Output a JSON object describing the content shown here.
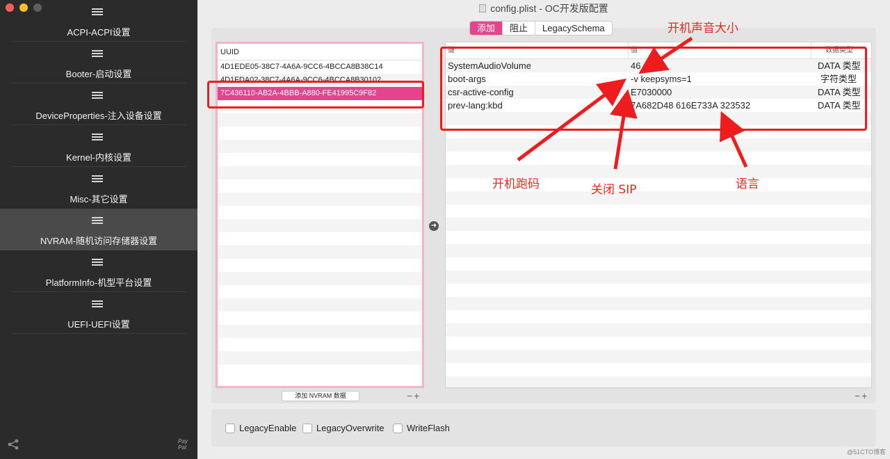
{
  "window": {
    "title": "config.plist - OC开发版配置"
  },
  "sidebar": {
    "items": [
      {
        "label": "ACPI-ACPI设置"
      },
      {
        "label": "Booter-启动设置"
      },
      {
        "label": "DeviceProperties-注入设备设置"
      },
      {
        "label": "Kernel-内核设置"
      },
      {
        "label": "Misc-其它设置"
      },
      {
        "label": "NVRAM-随机访问存储器设置",
        "active": true
      },
      {
        "label": "PlatformInfo-机型平台设置"
      },
      {
        "label": "UEFI-UEFI设置"
      }
    ],
    "paypal_line1": "Pay",
    "paypal_line2": "Pal"
  },
  "tabs": [
    "添加",
    "阻止",
    "LegacySchema"
  ],
  "uuid_table": {
    "header": "UUID",
    "rows": [
      "4D1EDE05-38C7-4A6A-9CC6-4BCCA8B38C14",
      "4D1FDA02-38C7-4A6A-9CC6-4BCCA8B30102",
      "7C436110-AB2A-4BBB-A880-FE41995C9F82"
    ]
  },
  "kv_table": {
    "header_key": "键",
    "header_value": "值",
    "header_type": "数据类型",
    "rows": [
      {
        "key": "SystemAudioVolume",
        "value": "46",
        "type": "DATA 类型"
      },
      {
        "key": "boot-args",
        "value": "-v keepsyms=1",
        "type": "字符类型"
      },
      {
        "key": "csr-active-config",
        "value": "E7030000",
        "type": "DATA 类型"
      },
      {
        "key": "prev-lang:kbd",
        "value": "7A682D48 616E733A 323532",
        "type": "DATA 类型"
      }
    ]
  },
  "add_nvram_button": "添加 NVRAM 数据",
  "checkboxes": [
    "LegacyEnable",
    "LegacyOverwrite",
    "WriteFlash"
  ],
  "annotations": {
    "volume": "开机声音大小",
    "bootargs": "开机跑码",
    "sip": "关闭 SIP",
    "lang": "语言"
  },
  "watermark": "@51CTO博客",
  "colors": {
    "accent": "#e5448c",
    "annotation": "#e8291c",
    "sidebar_bg": "#2b2b2b"
  }
}
